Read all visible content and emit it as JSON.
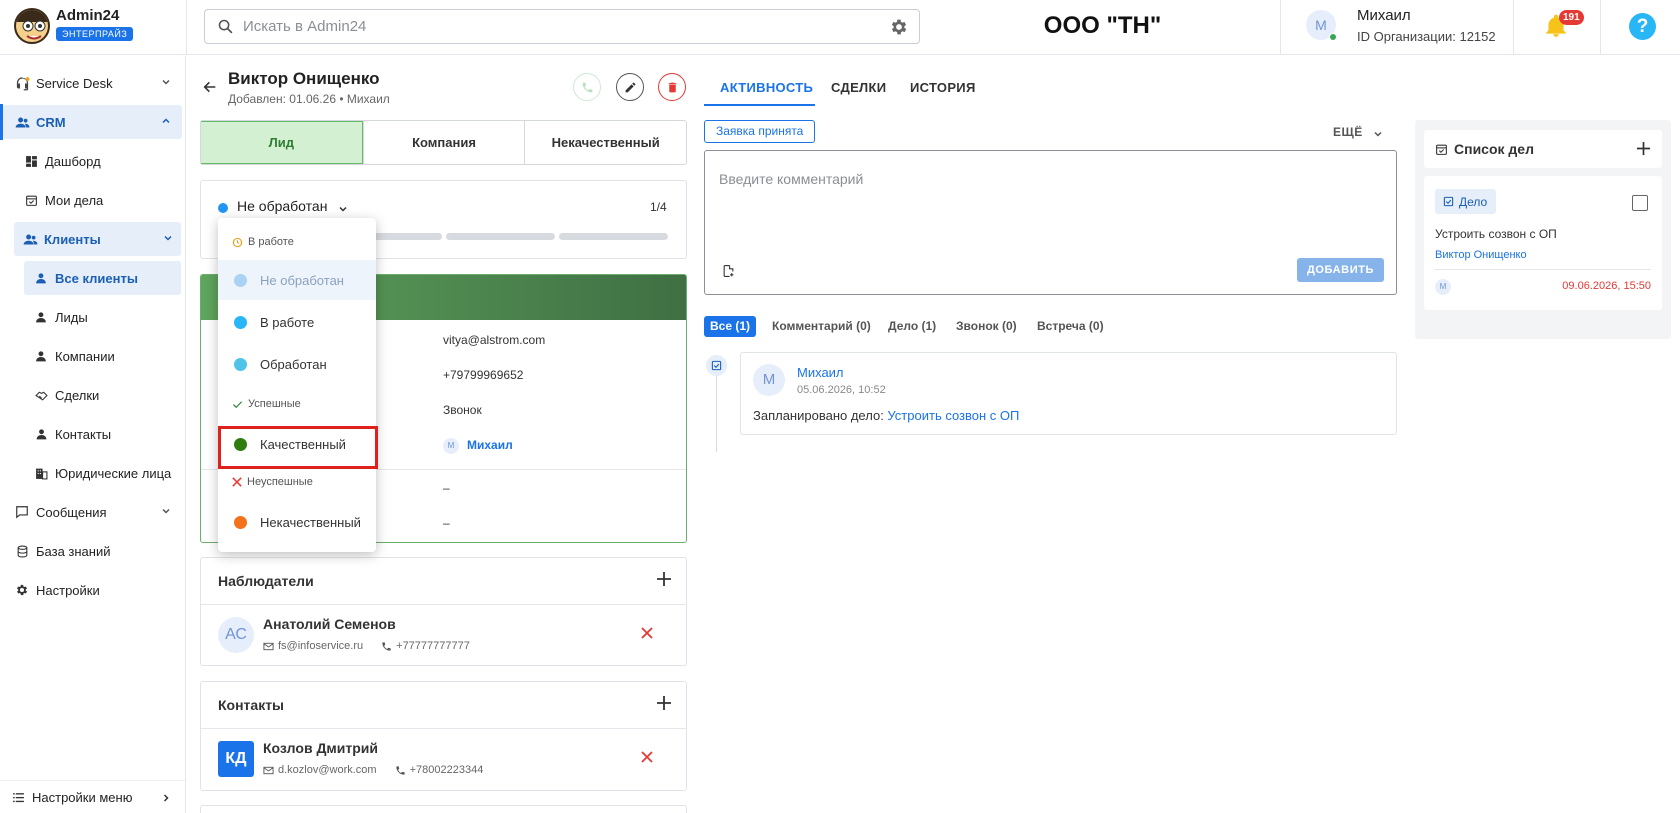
{
  "app": {
    "name": "Admin24",
    "badge": "ЭНТЕРПРАЙЗ"
  },
  "search": {
    "placeholder": "Искать в Admin24"
  },
  "org": {
    "title": "ООО \"ТН\""
  },
  "user": {
    "initial": "М",
    "name": "Михаил",
    "org_id": "ID Организации: 12152"
  },
  "notifications": {
    "count": "191"
  },
  "help": {
    "label": "?"
  },
  "sidebar": {
    "items": [
      {
        "label": "Service Desk"
      },
      {
        "label": "CRM"
      },
      {
        "label": "Дашборд"
      },
      {
        "label": "Мои дела"
      },
      {
        "label": "Клиенты"
      },
      {
        "label": "Все клиенты"
      },
      {
        "label": "Лиды"
      },
      {
        "label": "Компании"
      },
      {
        "label": "Сделки"
      },
      {
        "label": "Контакты"
      },
      {
        "label": "Юридические лица"
      },
      {
        "label": "Сообщения"
      },
      {
        "label": "База знаний"
      },
      {
        "label": "Настройки"
      }
    ],
    "footer": "Настройки меню"
  },
  "contact": {
    "name": "Виктор Онищенко",
    "added": "Добавлен: 01.06.26 • Михаил",
    "types": [
      "Лид",
      "Компания",
      "Некачественный"
    ]
  },
  "status": {
    "current": "Не обработан",
    "step": "1/4"
  },
  "info": {
    "email": "vitya@alstrom.com",
    "phone": "+79799969652",
    "source": "Звонок",
    "owner_initial": "М",
    "owner": "Михаил",
    "field1": "–",
    "field2": "–"
  },
  "dropdown": {
    "group_in_work": "В работе",
    "item_not_processed": "Не обработан",
    "item_in_work": "В работе",
    "item_processed": "Обработан",
    "group_success": "Успешные",
    "item_quality": "Качественный",
    "group_fail": "Неуспешные",
    "item_poor": "Некачественный"
  },
  "observers": {
    "title": "Наблюдатели",
    "person": {
      "initials": "АС",
      "name": "Анатолий Семенов",
      "email": "fs@infoservice.ru",
      "phone": "+77777777777"
    }
  },
  "contacts": {
    "title": "Контакты",
    "person": {
      "initials": "КД",
      "name": "Козлов Дмитрий",
      "email": "d.kozlov@work.com",
      "phone": "+78002223344"
    }
  },
  "activity": {
    "tabs": [
      "АКТИВНОСТЬ",
      "СДЕЛКИ",
      "ИСТОРИЯ"
    ],
    "request_badge": "Заявка принята",
    "more": "ЕЩЁ",
    "comment_placeholder": "Введите комментарий",
    "add_button": "ДОБАВИТЬ",
    "filters": [
      "Все (1)",
      "Комментарий (0)",
      "Дело (1)",
      "Звонок (0)",
      "Встреча (0)"
    ],
    "entry": {
      "initial": "М",
      "author": "Михаил",
      "time": "05.06.2026, 10:52",
      "text": "Запланировано дело: ",
      "link": "Устроить созвон с ОП"
    }
  },
  "todo": {
    "title": "Список дел",
    "chip": "Дело",
    "text": "Устроить созвон с ОП",
    "client": "Виктор Онищенко",
    "initial": "М",
    "date": "09.06.2026, 15:50"
  },
  "colors": {
    "accent": "#1a73e8",
    "lead_green": "#2e7d32",
    "status_new": "#2196f3",
    "status_quality": "#2e7d0f",
    "status_poor": "#f4721c",
    "danger": "#e53935"
  }
}
